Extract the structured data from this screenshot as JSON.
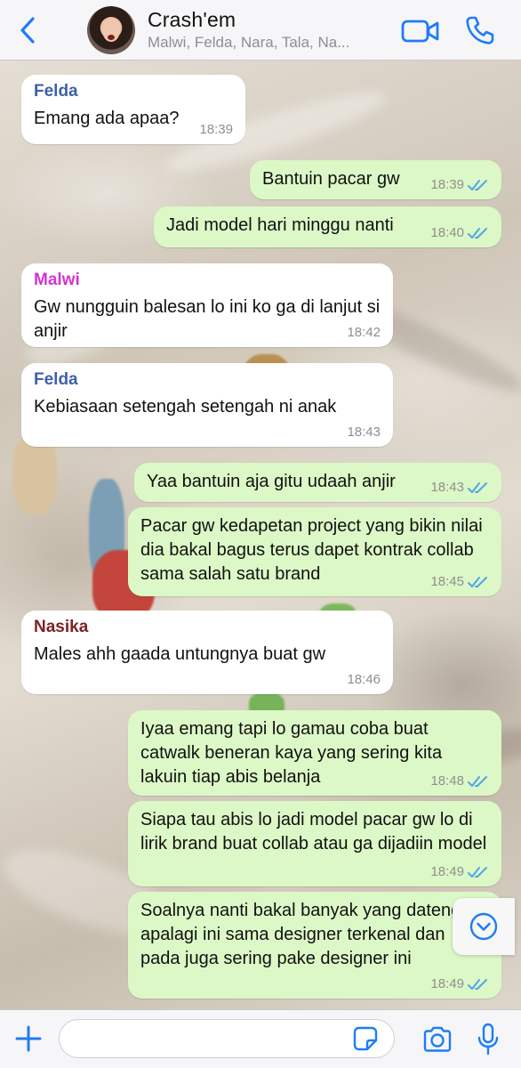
{
  "header": {
    "title": "Crash'em",
    "members": "Malwi, Felda, Nara, Tala, Na..."
  },
  "colors": {
    "accent": "#1f7cf5",
    "incoming_bubble": "#ffffff",
    "outgoing_bubble": "#dcf8c6",
    "sender_felda": "#3f5fa8",
    "sender_malwi": "#d333d1",
    "sender_nasika": "#7d2222",
    "read_ticks": "#4fa6e6"
  },
  "icons": {
    "back": "chevron-left-icon",
    "video": "video-camera-icon",
    "call": "phone-icon",
    "scroll": "chevron-down-circle-icon",
    "plus": "plus-icon",
    "sticker": "sticker-icon",
    "camera": "camera-icon",
    "mic": "microphone-icon"
  },
  "messages": [
    {
      "sender": "Felda",
      "text": "Emang ada apaa?",
      "time": "18:39"
    },
    {
      "text": "Bantuin pacar gw",
      "time": "18:39"
    },
    {
      "text": "Jadi model hari minggu nanti",
      "time": "18:40"
    },
    {
      "sender": "Malwi",
      "text": "Gw nungguin balesan lo ini ko ga di lanjut si anjir",
      "time": "18:42"
    },
    {
      "sender": "Felda",
      "text": "Kebiasaan setengah setengah ni anak",
      "time": "18:43"
    },
    {
      "text": "Yaa bantuin aja gitu udaah anjir",
      "time": "18:43"
    },
    {
      "text": "Pacar gw kedapetan project yang bikin nilai dia bakal bagus terus dapet kontrak collab sama salah satu brand",
      "time": "18:45"
    },
    {
      "sender": "Nasika",
      "text": "Males ahh gaada untungnya buat gw",
      "time": "18:46"
    },
    {
      "text": "Iyaa emang tapi lo gamau coba buat catwalk beneran kaya yang sering kita lakuin tiap abis belanja",
      "time": "18:48"
    },
    {
      "text": "Siapa tau abis lo jadi model pacar gw lo di lirik brand buat collab atau ga dijadiin model",
      "time": "18:49"
    },
    {
      "text": "Soalnya nanti bakal banyak yang dateng apalagi ini sama designer terkenal dan pada juga sering pake designer ini",
      "time": "18:49"
    }
  ],
  "composer": {
    "value": "",
    "placeholder": ""
  }
}
